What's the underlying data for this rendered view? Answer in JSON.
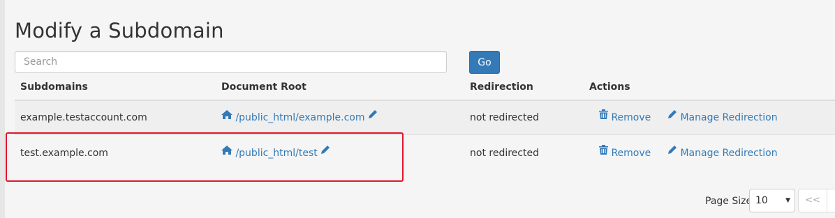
{
  "page": {
    "title": "Modify a Subdomain"
  },
  "search": {
    "placeholder": "Search",
    "go_label": "Go"
  },
  "table": {
    "headers": {
      "subdomains": "Subdomains",
      "document_root": "Document Root",
      "redirection": "Redirection",
      "actions": "Actions"
    },
    "rows": [
      {
        "subdomain": "example.testaccount.com",
        "document_root": "/public_html/example.com",
        "redirection": "not redirected",
        "remove": "Remove",
        "manage": "Manage Redirection"
      },
      {
        "subdomain": "test.example.com",
        "document_root": "/public_html/test",
        "redirection": "not redirected",
        "remove": "Remove",
        "manage": "Manage Redirection"
      }
    ]
  },
  "pagination": {
    "page_size_label": "Page Size",
    "page_size_value": "10",
    "first_label": "<<"
  },
  "colors": {
    "link": "#337ab7",
    "button": "#337ab7",
    "highlight": "#e0152b"
  },
  "icons": [
    "home-icon",
    "pencil-icon",
    "trash-icon",
    "caret-down-icon"
  ]
}
